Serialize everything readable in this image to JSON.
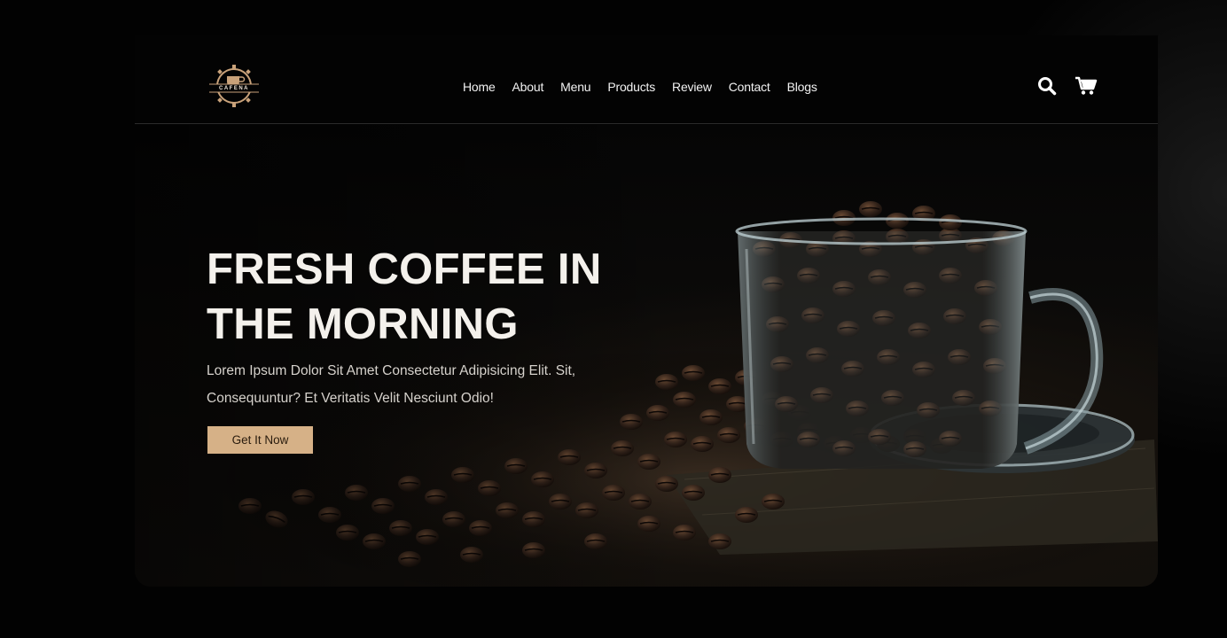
{
  "brand": {
    "logo_text": "CAFENA"
  },
  "nav": {
    "items": [
      {
        "label": "Home"
      },
      {
        "label": "About"
      },
      {
        "label": "Menu"
      },
      {
        "label": "Products"
      },
      {
        "label": "Review"
      },
      {
        "label": "Contact"
      },
      {
        "label": "Blogs"
      }
    ],
    "icons": [
      "search-icon",
      "shopping-cart-icon"
    ]
  },
  "hero": {
    "title_line1": "FRESH COFFEE IN",
    "title_line2": "THE MORNING",
    "text_line1": "Lorem Ipsum Dolor Sit Amet Consectetur Adipisicing Elit. Sit,",
    "text_line2": "Consequuntur? Et Veritatis Velit Nesciunt Odio!",
    "button_label": "Get It Now"
  },
  "colors": {
    "accent": "#d6b187",
    "background": "#030303",
    "text": "#f4f1ec"
  }
}
